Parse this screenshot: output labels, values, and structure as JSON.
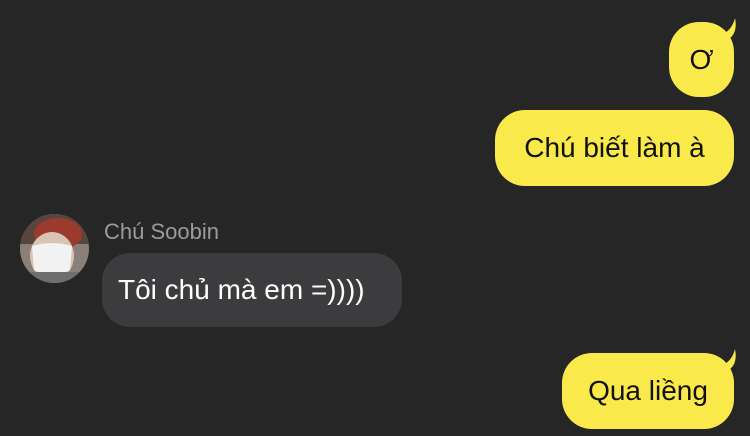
{
  "colors": {
    "background": "#262626",
    "outgoing_bubble": "#fae94a",
    "incoming_bubble": "#3c3c3e",
    "sender_name": "#9b9b9b"
  },
  "messages": [
    {
      "direction": "outgoing",
      "text": "Ơ"
    },
    {
      "direction": "outgoing",
      "text": "Chú biết làm à"
    },
    {
      "direction": "incoming",
      "sender": "Chú Soobin",
      "avatar_icon": "avatar-icon",
      "text": "Tôi chủ mà em =))))"
    },
    {
      "direction": "outgoing",
      "text": "Qua liềng"
    }
  ]
}
